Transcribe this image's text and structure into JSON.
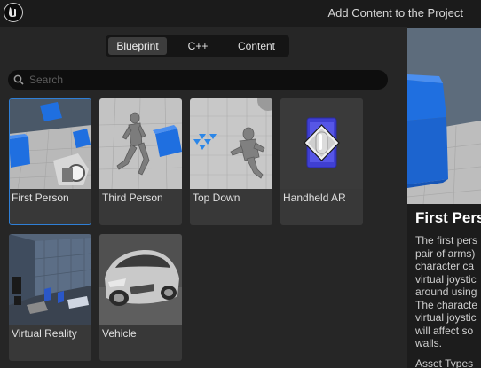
{
  "window": {
    "title": "Add Content to the Project"
  },
  "tabs": [
    {
      "label": "Blueprint",
      "active": true
    },
    {
      "label": "C++",
      "active": false
    },
    {
      "label": "Content",
      "active": false
    }
  ],
  "search": {
    "placeholder": "Search",
    "value": ""
  },
  "templates": [
    {
      "label": "First Person",
      "selected": true
    },
    {
      "label": "Third Person",
      "selected": false
    },
    {
      "label": "Top Down",
      "selected": false
    },
    {
      "label": "Handheld AR",
      "selected": false
    },
    {
      "label": "Virtual Reality",
      "selected": false
    },
    {
      "label": "Vehicle",
      "selected": false
    }
  ],
  "details": {
    "title": "First Pers",
    "description_lines": [
      "The first pers",
      "pair of arms)",
      "character ca",
      "virtual joystic",
      "around using",
      "The characte",
      "virtual joystic",
      "will affect so",
      "walls."
    ],
    "asset_types_label": "Asset Types"
  },
  "colors": {
    "selection": "#2f7fd6",
    "panel": "#262626",
    "topbar": "#1b1b1b",
    "cube_blue": "#1f6fe0"
  }
}
